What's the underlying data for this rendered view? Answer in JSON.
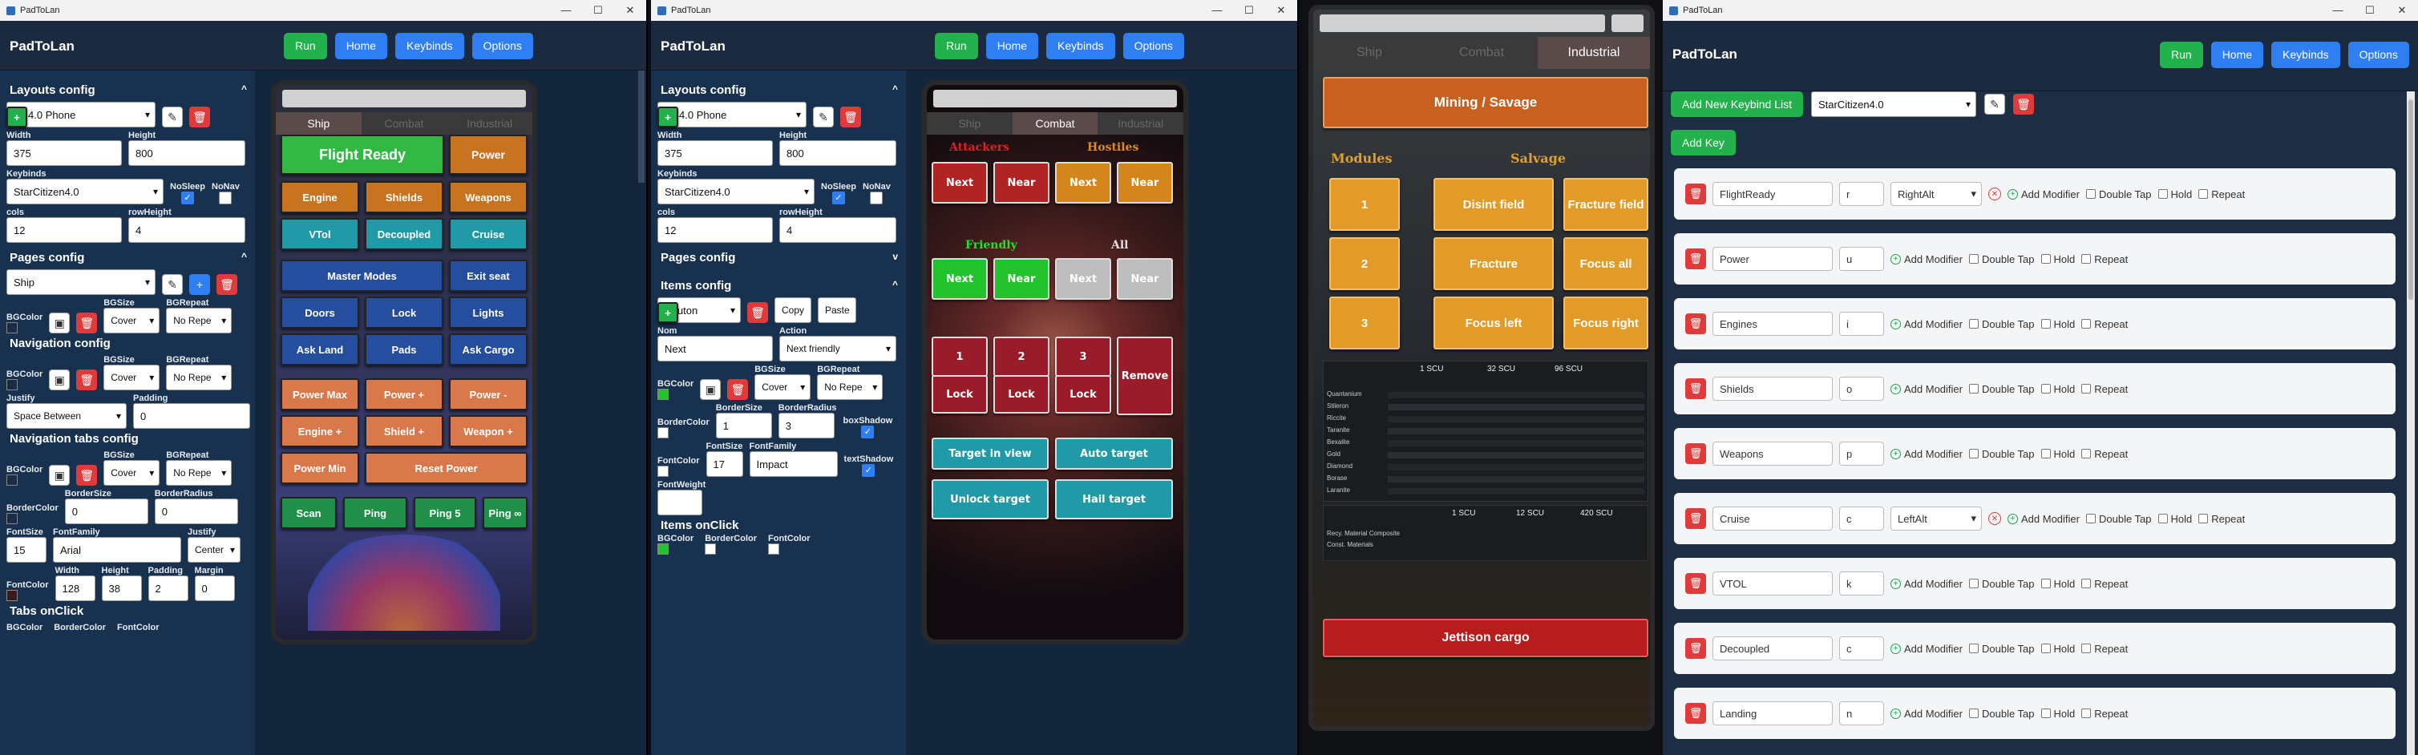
{
  "windows": {
    "win1": {
      "title": "PadToLan"
    },
    "win2": {
      "title": "PadToLan"
    },
    "win4": {
      "title": "PadToLan"
    }
  },
  "app": {
    "title": "PadToLan",
    "nav": {
      "run": "Run",
      "home": "Home",
      "keybinds": "Keybinds",
      "options": "Options"
    }
  },
  "colors": {
    "green": "#22b14c",
    "blue": "#2f7ff2",
    "red": "#e03a3a",
    "panel": "#17314f"
  },
  "win1": {
    "layouts_title": "Layouts config",
    "layout_select": "SC4.0 Phone",
    "width_label": "Width",
    "width": "375",
    "height_label": "Height",
    "height": "800",
    "keybinds_label": "Keybinds",
    "keybinds": "StarCitizen4.0",
    "nosleep_label": "NoSleep",
    "nonav_label": "NoNav",
    "cols_label": "cols",
    "cols": "12",
    "rowheight_label": "rowHeight",
    "rowheight": "4",
    "pages_title": "Pages config",
    "page_select": "Ship",
    "bgcolor_label": "BGColor",
    "bgsize_label": "BGSize",
    "bgrepeat_label": "BGRepeat",
    "bgsize": "Cover",
    "bgrepeat": "No Repe",
    "navcfg_title": "Navigation config",
    "justify_label": "Justify",
    "justify": "Space Between",
    "padding_label": "Padding",
    "padding": "0",
    "navtabs_title": "Navigation tabs config",
    "bordercolor_label": "BorderColor",
    "bordersize_label": "BorderSize",
    "bordersize": "0",
    "borderradius_label": "BorderRadius",
    "borderradius": "0",
    "fontsize_label": "FontSize",
    "fontsize": "15",
    "fontfamily_label": "FontFamily",
    "fontfamily": "Arial",
    "justify2_label": "Justify",
    "justify2": "Center",
    "fontcolor_label": "FontColor",
    "w_label": "Width",
    "w": "128",
    "h_label": "Height",
    "h": "38",
    "pad_label": "Padding",
    "pad": "2",
    "margin_label": "Margin",
    "margin": "0",
    "tabsonclick_title": "Tabs onClick",
    "oc_bgcolor": "BGColor",
    "oc_bordercolor": "BorderColor",
    "oc_fontcolor": "FontColor",
    "phone": {
      "tabs": [
        "Ship",
        "Combat",
        "Industrial"
      ],
      "buttons": [
        {
          "label": "Flight Ready",
          "color": "#33b844"
        },
        {
          "label": "Power",
          "color": "#c8731f"
        },
        {
          "label": "Engine",
          "color": "#c8731f"
        },
        {
          "label": "Shields",
          "color": "#c8731f"
        },
        {
          "label": "Weapons",
          "color": "#c8731f"
        },
        {
          "label": "VTol",
          "color": "#1f9aa6"
        },
        {
          "label": "Decoupled",
          "color": "#1f9aa6"
        },
        {
          "label": "Cruise",
          "color": "#1f9aa6"
        },
        {
          "label": "Master Modes",
          "color": "#254f9e"
        },
        {
          "label": "Exit seat",
          "color": "#254f9e"
        },
        {
          "label": "Doors",
          "color": "#254f9e"
        },
        {
          "label": "Lock",
          "color": "#254f9e"
        },
        {
          "label": "Lights",
          "color": "#254f9e"
        },
        {
          "label": "Ask Land",
          "color": "#254f9e"
        },
        {
          "label": "Pads",
          "color": "#254f9e"
        },
        {
          "label": "Ask Cargo",
          "color": "#254f9e"
        },
        {
          "label": "Power Max",
          "color": "#d9784a"
        },
        {
          "label": "Power +",
          "color": "#d9784a"
        },
        {
          "label": "Power -",
          "color": "#d9784a"
        },
        {
          "label": "Engine +",
          "color": "#d9784a"
        },
        {
          "label": "Shield +",
          "color": "#d9784a"
        },
        {
          "label": "Weapon +",
          "color": "#d9784a"
        },
        {
          "label": "Power Min",
          "color": "#d9784a"
        },
        {
          "label": "Reset Power",
          "color": "#d9784a"
        },
        {
          "label": "Scan",
          "color": "#1f8f4a"
        },
        {
          "label": "Ping",
          "color": "#1f8f4a"
        },
        {
          "label": "Ping 5",
          "color": "#1f8f4a"
        },
        {
          "label": "Ping ∞",
          "color": "#1f8f4a"
        }
      ]
    }
  },
  "win2": {
    "layouts_title": "Layouts config",
    "layout_select": "SC4.0 Phone",
    "width_label": "Width",
    "width": "375",
    "height_label": "Height",
    "height": "800",
    "keybinds_label": "Keybinds",
    "keybinds": "StarCitizen4.0",
    "nosleep_label": "NoSleep",
    "nonav_label": "NoNav",
    "cols_label": "cols",
    "cols": "12",
    "rowheight_label": "rowHeight",
    "rowheight": "4",
    "pages_title": "Pages config",
    "items_title": "Items config",
    "item_type": "Bouton",
    "copy": "Copy",
    "paste": "Paste",
    "nom_label": "Nom",
    "nom": "Next",
    "action_label": "Action",
    "action": "Next friendly",
    "bgcolor_label": "BGColor",
    "bgsize_label": "BGSize",
    "bgsize": "Cover",
    "bgrepeat_label": "BGRepeat",
    "bgrepeat": "No Repe",
    "bordercolor_label": "BorderColor",
    "bordersize_label": "BorderSize",
    "bordersize": "1",
    "borderradius_label": "BorderRadius",
    "borderradius": "3",
    "boxshadow_label": "boxShadow",
    "fontcolor_label": "FontColor",
    "fontsize_label": "FontSize",
    "fontsize": "17",
    "fontfamily_label": "FontFamily",
    "fontfamily": "Impact",
    "textshadow_label": "textShadow",
    "fontweight_label": "FontWeight",
    "itemsonclick_title": "Items onClick",
    "oc_bgcolor": "BGColor",
    "oc_bordercolor": "BorderColor",
    "oc_fontcolor": "FontColor",
    "phone": {
      "tabs": [
        "Ship",
        "Combat",
        "Industrial"
      ],
      "attackers": "Attackers",
      "hostiles": "Hostiles",
      "friendly": "Friendly",
      "all": "All",
      "buttons": [
        {
          "label": "Next",
          "color": "#b02424"
        },
        {
          "label": "Near",
          "color": "#b02424"
        },
        {
          "label": "Next",
          "color": "#d4861c"
        },
        {
          "label": "Near",
          "color": "#d4861c"
        },
        {
          "label": "Next",
          "color": "#21c22b"
        },
        {
          "label": "Near",
          "color": "#21c22b"
        },
        {
          "label": "Next",
          "color": "#bdbdbd"
        },
        {
          "label": "Near",
          "color": "#bdbdbd"
        },
        {
          "label": "1",
          "color": "#9a1c2a"
        },
        {
          "label": "2",
          "color": "#9a1c2a"
        },
        {
          "label": "3",
          "color": "#9a1c2a"
        },
        {
          "label": "Remove",
          "color": "#9a1c2a"
        },
        {
          "label": "Lock",
          "color": "#9a1c2a"
        },
        {
          "label": "Lock",
          "color": "#9a1c2a"
        },
        {
          "label": "Lock",
          "color": "#9a1c2a"
        },
        {
          "label": "Target in view",
          "color": "#1f9aa6"
        },
        {
          "label": "Auto target",
          "color": "#1f9aa6"
        },
        {
          "label": "Unlock target",
          "color": "#1f9aa6"
        },
        {
          "label": "Hail target",
          "color": "#1f9aa6"
        }
      ]
    }
  },
  "win3": {
    "tabs": [
      "Ship",
      "Combat",
      "Industrial"
    ],
    "mining": "Mining / Savage",
    "modules": "Modules",
    "salvage": "Salvage",
    "buttons": [
      {
        "label": "1"
      },
      {
        "label": "Disint field"
      },
      {
        "label": "Fracture field"
      },
      {
        "label": "2"
      },
      {
        "label": "Fracture"
      },
      {
        "label": "Focus all"
      },
      {
        "label": "3"
      },
      {
        "label": "Focus left"
      },
      {
        "label": "Focus right"
      }
    ],
    "scu_headers": [
      "1 SCU",
      "32 SCU",
      "96 SCU"
    ],
    "scu_headers2": [
      "1 SCU",
      "12 SCU",
      "420 SCU"
    ],
    "table_rows": [
      "Quantanium",
      "Stileron",
      "Riccite",
      "Taranite",
      "Bexalite",
      "Gold",
      "Diamond",
      "Borase",
      "Laranite"
    ],
    "table2_rows": [
      "Recy. Material Composite",
      "Const. Materials"
    ],
    "jettison": "Jettison cargo"
  },
  "win4": {
    "add_list": "Add New Keybind List",
    "list_select": "StarCitizen4.0",
    "add_key": "Add Key",
    "add_modifier": "Add Modifier",
    "double_tap": "Double Tap",
    "hold": "Hold",
    "repeat": "Repeat",
    "rows": [
      {
        "name": "FlightReady",
        "key": "r",
        "modifier": "RightAlt"
      },
      {
        "name": "Power",
        "key": "u",
        "modifier": ""
      },
      {
        "name": "Engines",
        "key": "i",
        "modifier": ""
      },
      {
        "name": "Shields",
        "key": "o",
        "modifier": ""
      },
      {
        "name": "Weapons",
        "key": "p",
        "modifier": ""
      },
      {
        "name": "Cruise",
        "key": "c",
        "modifier": "LeftAlt"
      },
      {
        "name": "VTOL",
        "key": "k",
        "modifier": ""
      },
      {
        "name": "Decoupled",
        "key": "c",
        "modifier": ""
      },
      {
        "name": "Landing",
        "key": "n",
        "modifier": ""
      }
    ]
  }
}
